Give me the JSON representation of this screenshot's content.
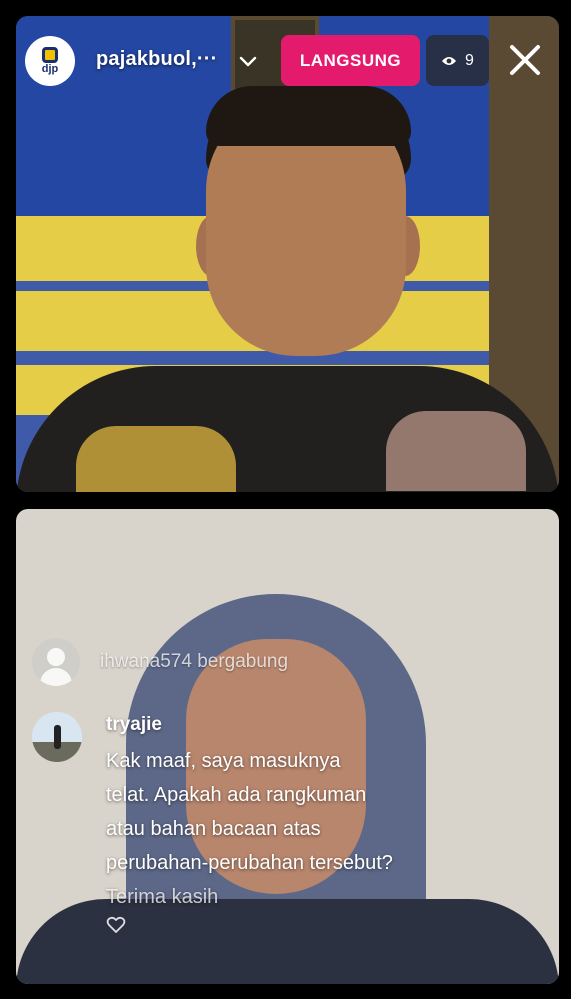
{
  "header": {
    "host_name": "pajakbuol,···",
    "avatar_logo_text": "djp",
    "live_label": "LANGSUNG",
    "viewer_count": "9",
    "icons": [
      "chevron-down-icon",
      "eye-icon",
      "close-icon"
    ]
  },
  "join_event": {
    "text": "ihwana574 bergabung"
  },
  "comment": {
    "username": "tryajie",
    "lines": [
      "Kak maaf, saya masuknya",
      "telat. Apakah ada rangkuman",
      "atau bahan bacaan atas",
      "perubahan-perubahan tersebut?",
      "Terima kasih"
    ]
  },
  "colors": {
    "live_badge": "#e41b6c",
    "background": "#000000"
  }
}
